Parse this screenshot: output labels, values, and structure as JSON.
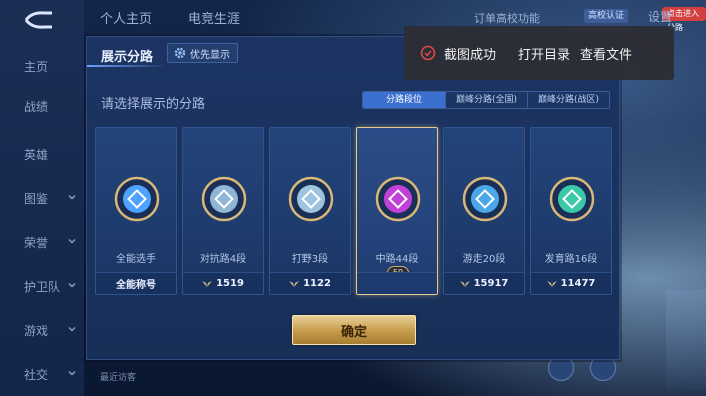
{
  "top": {
    "tabs": [
      "个人主页",
      "电竞生涯"
    ],
    "label_partial": "订单高校功能",
    "badge": "高校认证",
    "red_tip": "点击进入分路",
    "settings": "设置"
  },
  "rail": {
    "items": [
      {
        "label": "主页",
        "has_chevron": false
      },
      {
        "label": "战绩",
        "has_chevron": false
      },
      {
        "label": "英雄",
        "has_chevron": false
      },
      {
        "label": "图鉴",
        "has_chevron": true
      },
      {
        "label": "荣誉",
        "has_chevron": true
      },
      {
        "label": "护卫队",
        "has_chevron": true
      },
      {
        "label": "游戏",
        "has_chevron": true
      },
      {
        "label": "社交",
        "has_chevron": true
      }
    ]
  },
  "recent_visitors": "最近访客",
  "dialog": {
    "title": "展示分路",
    "priority_button": "优先显示",
    "subtitle": "请选择展示的分路",
    "tabs": [
      {
        "label": "分路段位",
        "active": true
      },
      {
        "label": "巅峰分路(全国)",
        "active": false
      },
      {
        "label": "巅峰分路(战区)",
        "active": false
      }
    ],
    "cards": [
      {
        "name": "全能选手",
        "footer": "全能称号",
        "has_wings": false,
        "selected": false,
        "emblem_color": "#4da3ff"
      },
      {
        "name": "对抗路4段",
        "footer": "1519",
        "has_wings": true,
        "selected": false,
        "emblem_color": "#8fb6d6"
      },
      {
        "name": "打野3段",
        "footer": "1122",
        "has_wings": true,
        "selected": false,
        "emblem_color": "#9cc4de"
      },
      {
        "name": "中路44段",
        "footer": "",
        "has_wings": false,
        "selected": true,
        "level_badge": "50",
        "emblem_color": "#c040d8"
      },
      {
        "name": "游走20段",
        "footer": "15917",
        "has_wings": true,
        "selected": false,
        "emblem_color": "#4aa8e8"
      },
      {
        "name": "发育路16段",
        "footer": "11477",
        "has_wings": true,
        "selected": false,
        "emblem_color": "#39c9a6"
      }
    ],
    "confirm": "确定"
  },
  "toast": {
    "message": "截图成功",
    "action_open_dir": "打开目录",
    "action_view_file": "查看文件"
  },
  "colors": {
    "accent_blue": "#3b6fd0",
    "gold": "#e8c98a",
    "toast_bg": "#2d2d34"
  }
}
